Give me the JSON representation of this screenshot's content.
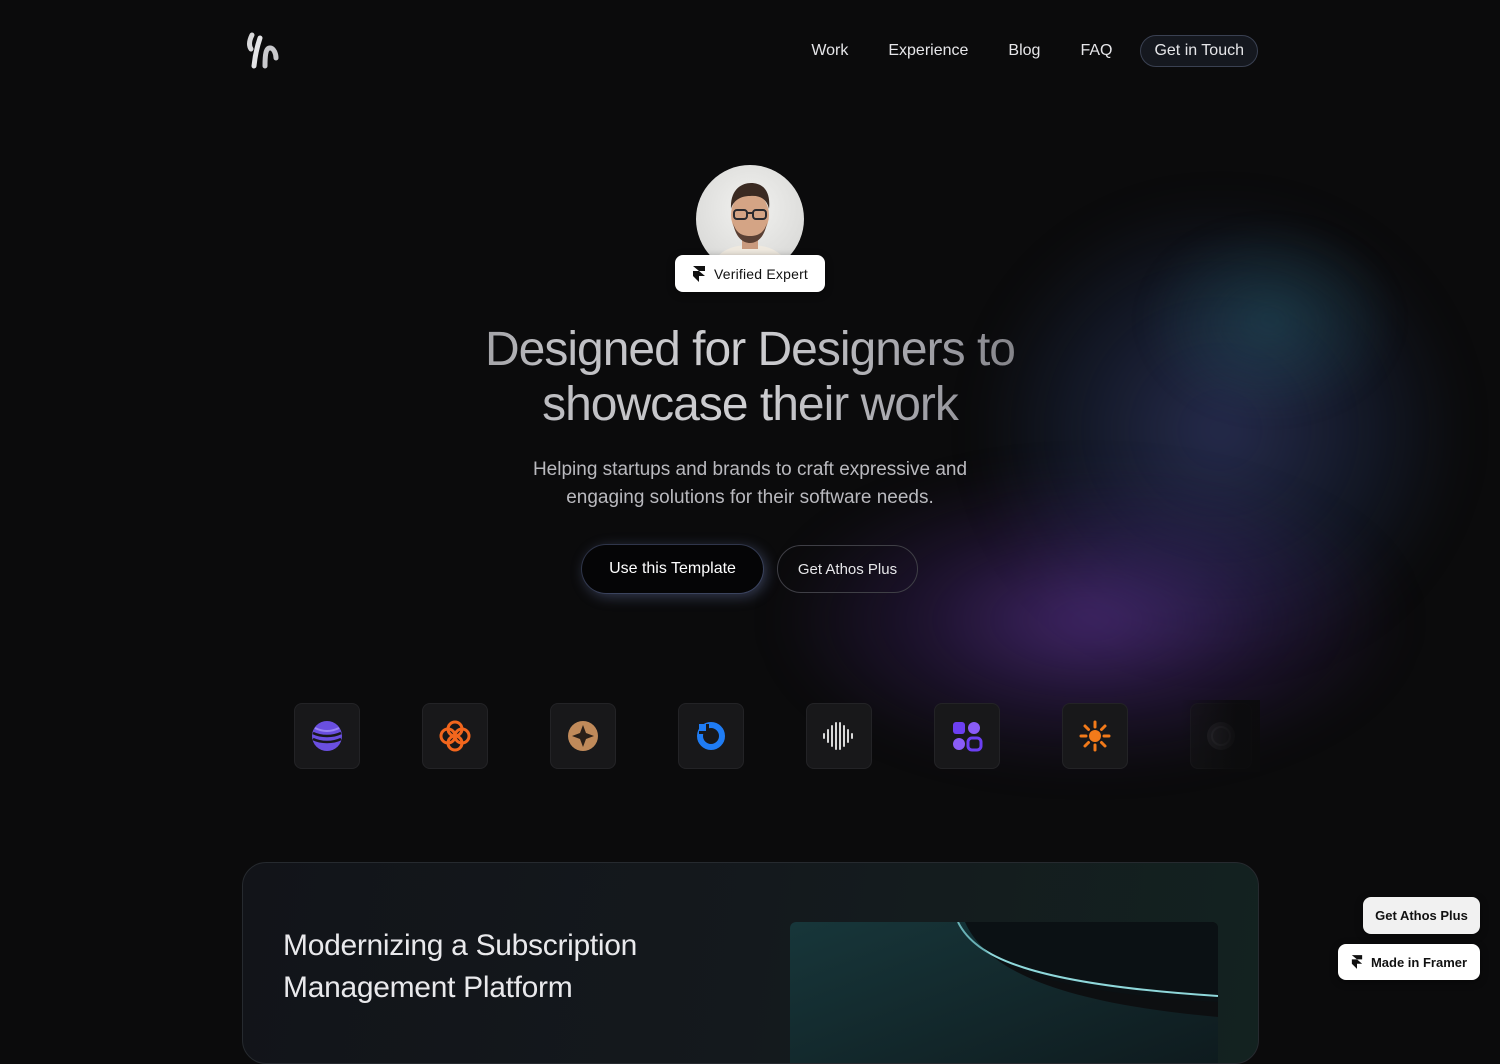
{
  "nav": {
    "items": [
      {
        "label": "Work"
      },
      {
        "label": "Experience"
      },
      {
        "label": "Blog"
      },
      {
        "label": "FAQ"
      }
    ],
    "cta": "Get in Touch"
  },
  "profile": {
    "badge": "Verified Expert"
  },
  "hero": {
    "title_line1": "Designed for Designers to",
    "title_line2": "showcase their work",
    "subtitle_line1": "Helping startups and brands to craft expressive and",
    "subtitle_line2": "engaging solutions for their software needs.",
    "primary_button": "Use this Template",
    "secondary_button": "Get Athos Plus"
  },
  "client_logos": [
    {
      "icon": "purple-sphere-icon",
      "color": "#7b5cf0"
    },
    {
      "icon": "orange-flower-icon",
      "color": "#f2661d"
    },
    {
      "icon": "compass-star-icon",
      "color": "#c08a5a"
    },
    {
      "icon": "blue-ring-icon",
      "color": "#1f7cf4"
    },
    {
      "icon": "sound-wave-icon",
      "color": "#d9d9d9"
    },
    {
      "icon": "purple-blocks-icon",
      "color": "#6c3ff2"
    },
    {
      "icon": "orange-sun-icon",
      "color": "#f27a1a"
    },
    {
      "icon": "dark-circle-icon",
      "color": "#3a3a3e"
    }
  ],
  "project": {
    "title_line1": "Modernizing a Subscription",
    "title_line2": "Management Platform"
  },
  "floating": {
    "athos_plus": "Get Athos Plus",
    "made_in_framer": "Made in Framer"
  }
}
